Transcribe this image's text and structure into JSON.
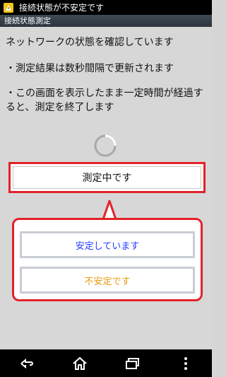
{
  "status_bar": {
    "text": "接続状態が不安定です",
    "icon": "warning-icon"
  },
  "title_bar": {
    "title": "接続状態測定"
  },
  "content": {
    "line1": "ネットワークの状態を確認しています",
    "line2": "・測定結果は数秒間隔で更新されます",
    "line3": "・この画面を表示したまま一定時間が経過すると、測定を終了します"
  },
  "measure_button": {
    "label": "測定中です"
  },
  "legend": {
    "stable_label": "安定しています",
    "unstable_label": "不安定です"
  },
  "colors": {
    "accent_red": "#e3222a",
    "stable_blue": "#1f3cff",
    "unstable_orange": "#e59a10"
  },
  "nav_bar": {
    "icons": [
      "back-icon",
      "home-icon",
      "recent-apps-icon",
      "menu-icon"
    ]
  }
}
